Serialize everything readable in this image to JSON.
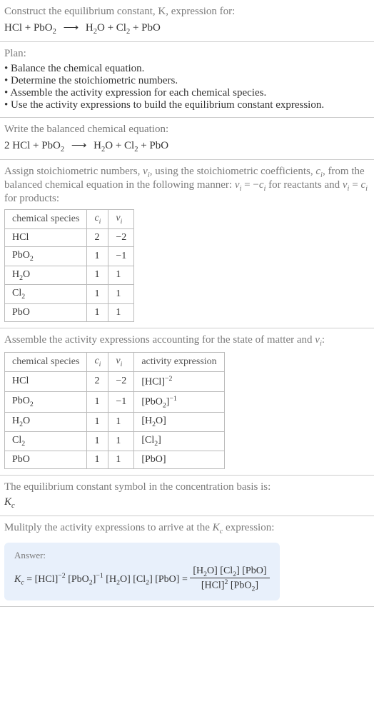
{
  "header": {
    "construct_line": "Construct the equilibrium constant, K, expression for:",
    "equation_lhs": "HCl + PbO",
    "equation_rhs": "H",
    "equation_full_parts": {
      "p1": "HCl + PbO",
      "p2": "2",
      "arrow": "⟶",
      "p3": "H",
      "p4": "2",
      "p5": "O + Cl",
      "p6": "2",
      "p7": " + PbO"
    }
  },
  "plan": {
    "title": "Plan:",
    "items": [
      "Balance the chemical equation.",
      "Determine the stoichiometric numbers.",
      "Assemble the activity expression for each chemical species.",
      "Use the activity expressions to build the equilibrium constant expression."
    ]
  },
  "balanced": {
    "title": "Write the balanced chemical equation:",
    "p1": "2 HCl + PbO",
    "p2": "2",
    "arrow": "⟶",
    "p3": "H",
    "p4": "2",
    "p5": "O + Cl",
    "p6": "2",
    "p7": " + PbO"
  },
  "assign": {
    "text_a": "Assign stoichiometric numbers, ",
    "nu": "ν",
    "sub_i": "i",
    "text_b": ", using the stoichiometric coefficients, ",
    "c": "c",
    "text_c": ", from the balanced chemical equation in the following manner: ",
    "eq1a": "ν",
    "eq1b": " = −",
    "eq1c": "c",
    "text_d": " for reactants and ",
    "eq2a": "ν",
    "eq2b": " = ",
    "eq2c": "c",
    "text_e": " for products:"
  },
  "table1": {
    "h1": "chemical species",
    "h2": "c",
    "h3": "ν",
    "rows": [
      {
        "s1": "HCl",
        "s2": "",
        "c": "2",
        "v": "−2"
      },
      {
        "s1": "PbO",
        "s2": "2",
        "c": "1",
        "v": "−1"
      },
      {
        "s1": "H",
        "s2": "2",
        "s3": "O",
        "c": "1",
        "v": "1"
      },
      {
        "s1": "Cl",
        "s2": "2",
        "c": "1",
        "v": "1"
      },
      {
        "s1": "PbO",
        "s2": "",
        "c": "1",
        "v": "1"
      }
    ]
  },
  "assemble": {
    "text_a": "Assemble the activity expressions accounting for the state of matter and ",
    "nu": "ν",
    "sub_i": "i",
    "colon": ":"
  },
  "table2": {
    "h1": "chemical species",
    "h2": "c",
    "h3": "ν",
    "h4": "activity expression",
    "rows": [
      {
        "s1": "HCl",
        "s2": "",
        "c": "2",
        "v": "−2",
        "a1": "[HCl]",
        "a2": "−2"
      },
      {
        "s1": "PbO",
        "s2": "2",
        "c": "1",
        "v": "−1",
        "a1": "[PbO",
        "a1b": "2",
        "a1c": "]",
        "a2": "−1"
      },
      {
        "s1": "H",
        "s2": "2",
        "s3": "O",
        "c": "1",
        "v": "1",
        "a1": "[H",
        "a1b": "2",
        "a1c": "O]"
      },
      {
        "s1": "Cl",
        "s2": "2",
        "c": "1",
        "v": "1",
        "a1": "[Cl",
        "a1b": "2",
        "a1c": "]"
      },
      {
        "s1": "PbO",
        "s2": "",
        "c": "1",
        "v": "1",
        "a1": "[PbO]"
      }
    ]
  },
  "symbol": {
    "text": "The equilibrium constant symbol in the concentration basis is:",
    "kc": "K",
    "kc_sub": "c"
  },
  "multiply": {
    "text_a": "Mulitply the activity expressions to arrive at the ",
    "kc": "K",
    "kc_sub": "c",
    "text_b": " expression:"
  },
  "answer": {
    "label": "Answer:",
    "kc": "K",
    "kc_sub": "c",
    "eq": " = ",
    "t1": "[HCl]",
    "e1": "−2",
    "t2": " [PbO",
    "t2s": "2",
    "t2c": "]",
    "e2": "−1",
    "t3": " [H",
    "t3s": "2",
    "t3c": "O] [Cl",
    "t3s2": "2",
    "t3d": "] [PbO] = ",
    "num": "[H",
    "nums": "2",
    "numc": "O] [Cl",
    "nums2": "2",
    "numd": "] [PbO]",
    "den": "[HCl]",
    "dene": "2",
    "denb": " [PbO",
    "denbs": "2",
    "denc": "]"
  }
}
